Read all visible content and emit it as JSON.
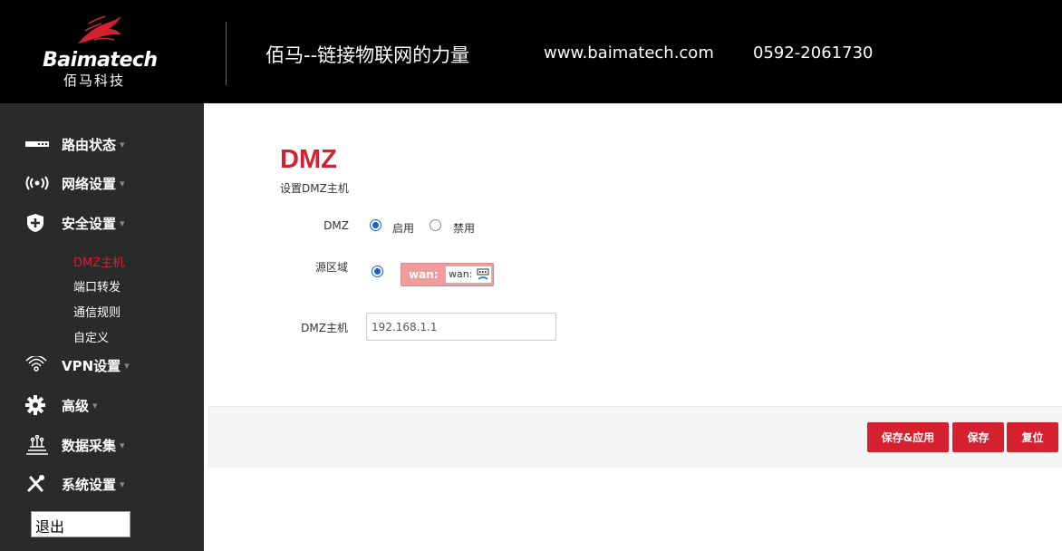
{
  "header": {
    "logo_text": "Baimatech",
    "logo_sub": "佰马科技",
    "slogan": "佰马--链接物联网的力量",
    "website": "www.baimatech.com",
    "phone": "0592-2061730"
  },
  "sidebar": {
    "items": [
      {
        "label": "路由状态",
        "icon": "router-icon"
      },
      {
        "label": "网络设置",
        "icon": "wireless-icon"
      },
      {
        "label": "安全设置",
        "icon": "shield-icon"
      },
      {
        "label": "VPN设置",
        "icon": "wifi-arc-icon"
      },
      {
        "label": "高级",
        "icon": "gear-icon"
      },
      {
        "label": "数据采集",
        "icon": "sensor-icon"
      },
      {
        "label": "系统设置",
        "icon": "tools-icon"
      }
    ],
    "caret": "▾",
    "sub_items": [
      "DMZ主机",
      "端口转发",
      "通信规则",
      "自定义"
    ],
    "active_sub": "DMZ主机",
    "logout": "退出"
  },
  "main": {
    "title": "DMZ",
    "description": "设置DMZ主机",
    "dmz_label": "DMZ",
    "enable_label": "启用",
    "disable_label": "禁用",
    "enabled": true,
    "source_zone_label": "源区域",
    "zone_name": "wan:",
    "zone_interface": "wan:",
    "host_label": "DMZ主机",
    "host_value": "192.168.1.1"
  },
  "actions": {
    "save_apply": "保存&应用",
    "save": "保存",
    "reset": "复位"
  },
  "colors": {
    "accent": "#d5202f",
    "header_bg": "#000000",
    "sidebar_bg": "#2a2a2a",
    "zone_bg": "#f09c9c",
    "radio": "#1a5fd6"
  }
}
